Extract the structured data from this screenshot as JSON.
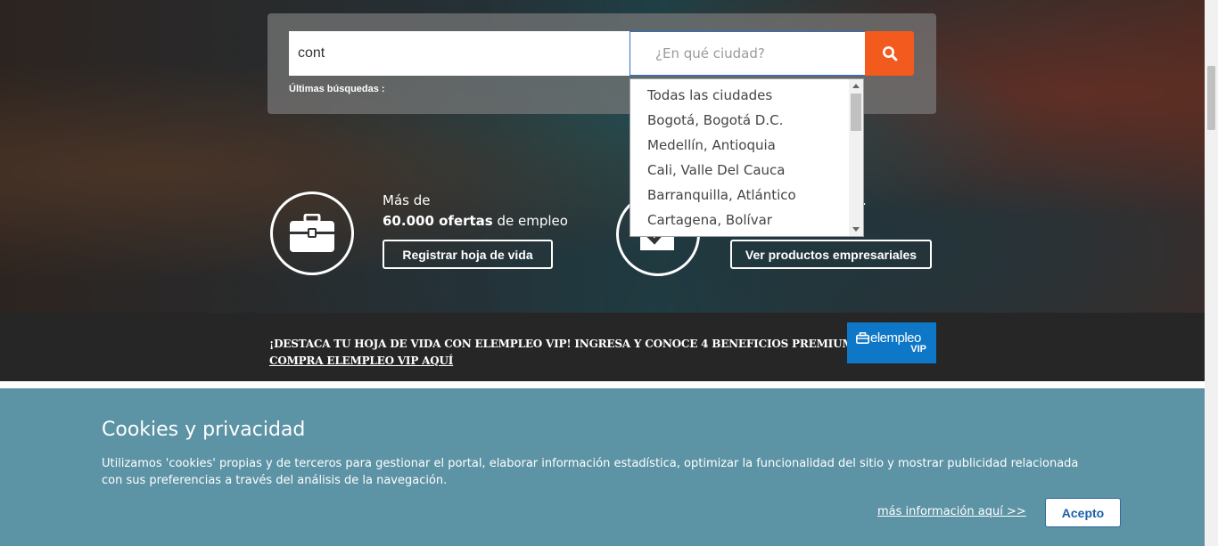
{
  "search": {
    "keyword_value": "cont",
    "city_placeholder": "¿En qué ciudad?",
    "recent_label": "Últimas búsquedas :"
  },
  "city_dropdown": {
    "options": [
      "Todas las ciudades",
      "Bogotá, Bogotá D.C.",
      "Medellín, Antioquia",
      "Cali, Valle Del Cauca",
      "Barranquilla, Atlántico",
      "Cartagena, Bolívar"
    ]
  },
  "features": {
    "candidates": {
      "line1": "Más de",
      "count": "60.000 ofertas",
      "suffix": " de empleo",
      "button": "Registrar hoja de vida",
      "icon": "briefcase-icon"
    },
    "companies": {
      "partial_text": ".",
      "button": "Ver productos empresariales",
      "icon": "checkmark-icon"
    }
  },
  "vip_banner": {
    "headline": "¡DESTACA TU HOJA DE VIDA CON ELEMPLEO VIP! INGRESA Y CONOCE 4 BENEFICIOS PREMIUM",
    "link": "COMPRA ELEMPLEO VIP AQUÍ",
    "logo_name": "elempleo",
    "logo_tag": "VIP"
  },
  "cookies": {
    "title": "Cookies y privacidad",
    "text": "Utilizamos 'cookies' propias y de terceros para gestionar el portal, elaborar información estadística, optimizar la funcionalidad del sitio y mostrar publicidad relacionada con sus preferencias a través del análisis de la navegación.",
    "more_link": "más información aquí >>",
    "accept": "Acepto"
  },
  "colors": {
    "search_button": "#f25a1e",
    "vip_logo": "#0f77c8",
    "cookie_bg": "#5c93a5",
    "vip_bar": "#262626"
  }
}
